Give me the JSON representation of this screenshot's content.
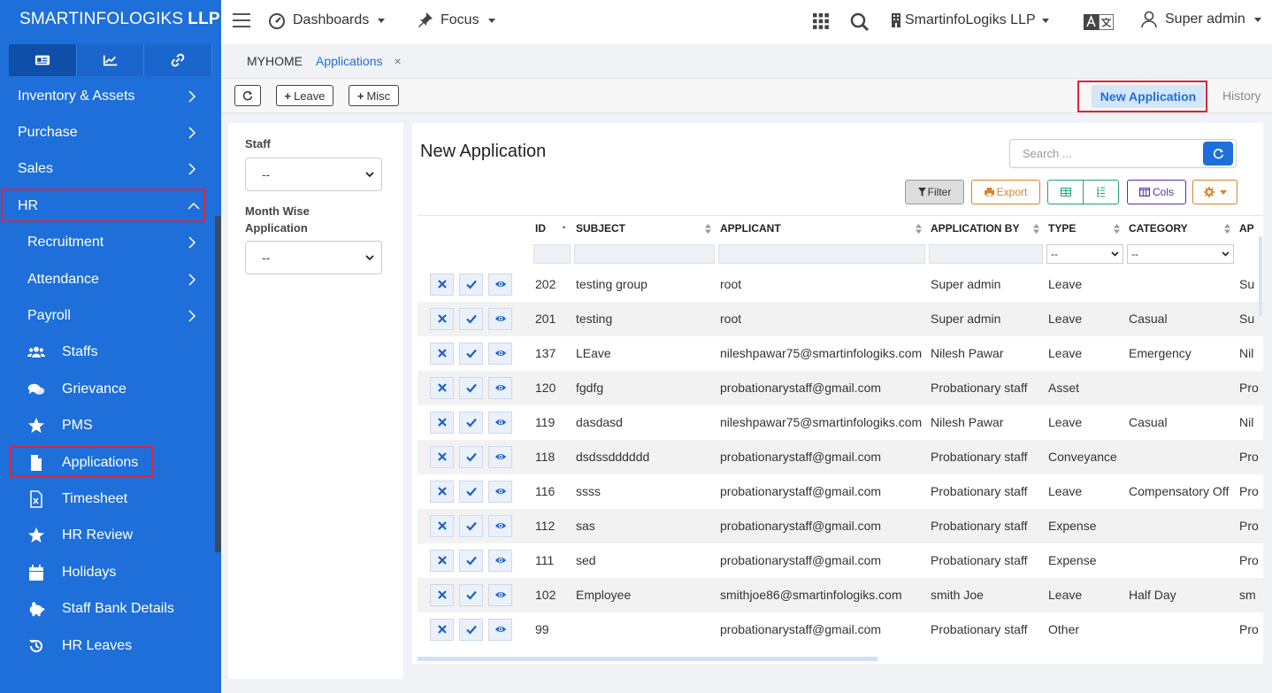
{
  "brand": {
    "name": "SMARTINFOLOGIKS",
    "suffix": "LLP"
  },
  "sidebar": {
    "tabs": [
      {
        "icon": "id-card-icon"
      },
      {
        "icon": "chart-line-icon"
      },
      {
        "icon": "link-icon"
      }
    ],
    "items": [
      {
        "label": "Inventory & Assets",
        "level": "top",
        "chevron": "right"
      },
      {
        "label": "Purchase",
        "level": "top",
        "chevron": "right"
      },
      {
        "label": "Sales",
        "level": "top",
        "chevron": "right"
      },
      {
        "label": "HR",
        "level": "top",
        "chevron": "up"
      },
      {
        "label": "Recruitment",
        "level": "sub",
        "chevron": "right"
      },
      {
        "label": "Attendance",
        "level": "sub",
        "chevron": "right"
      },
      {
        "label": "Payroll",
        "level": "sub",
        "chevron": "right"
      },
      {
        "label": "Staffs",
        "level": "leaf",
        "icon": "users-icon"
      },
      {
        "label": "Grievance",
        "level": "leaf",
        "icon": "comments-icon"
      },
      {
        "label": "PMS",
        "level": "leaf",
        "icon": "star-icon"
      },
      {
        "label": "Applications",
        "level": "leaf",
        "icon": "file-icon"
      },
      {
        "label": "Timesheet",
        "level": "leaf",
        "icon": "excel-file-icon"
      },
      {
        "label": "HR Review",
        "level": "leaf",
        "icon": "star-icon"
      },
      {
        "label": "Holidays",
        "level": "leaf",
        "icon": "calendar-icon"
      },
      {
        "label": "Staff Bank Details",
        "level": "leaf",
        "icon": "piggy-bank-icon"
      },
      {
        "label": "HR Leaves",
        "level": "leaf",
        "icon": "history-icon"
      }
    ]
  },
  "topbar": {
    "dashboards": "Dashboards",
    "focus": "Focus",
    "company": "SmartinfoLogiks LLP",
    "user": "Super admin"
  },
  "tabstrip": {
    "home": "MYHOME",
    "current": "Applications",
    "close": "×"
  },
  "actions": {
    "leave": "Leave",
    "misc": "Misc",
    "new_application": "New Application",
    "history": "History"
  },
  "filters": {
    "staff_label": "Staff",
    "staff_value": "--",
    "month_label_1": "Month Wise",
    "month_label_2": "Application",
    "month_value": "--"
  },
  "main": {
    "title": "New Application",
    "search_placeholder": "Search ...",
    "toolbar": {
      "filter": "Filter",
      "export": "Export",
      "cols": "Cols"
    },
    "columns": [
      "",
      "ID",
      "SUBJECT",
      "APPLICANT",
      "APPLICATION BY",
      "TYPE",
      "CATEGORY",
      "AP"
    ],
    "filter_select": "--",
    "rows": [
      {
        "id": "202",
        "subject": "testing group",
        "applicant": "root",
        "by": "Super admin",
        "type": "Leave",
        "category": "",
        "ap": "Su"
      },
      {
        "id": "201",
        "subject": "testing",
        "applicant": "root",
        "by": "Super admin",
        "type": "Leave",
        "category": "Casual",
        "ap": "Su"
      },
      {
        "id": "137",
        "subject": "LEave",
        "applicant": "nileshpawar75@smartinfologiks.com",
        "by": "Nilesh Pawar",
        "type": "Leave",
        "category": "Emergency",
        "ap": "Nil"
      },
      {
        "id": "120",
        "subject": "fgdfg",
        "applicant": "probationarystaff@gmail.com",
        "by": "Probationary staff",
        "type": "Asset",
        "category": "",
        "ap": "Pro"
      },
      {
        "id": "119",
        "subject": "dasdasd",
        "applicant": "nileshpawar75@smartinfologiks.com",
        "by": "Nilesh Pawar",
        "type": "Leave",
        "category": "Casual",
        "ap": "Nil"
      },
      {
        "id": "118",
        "subject": "dsdssdddddd",
        "applicant": "probationarystaff@gmail.com",
        "by": "Probationary staff",
        "type": "Conveyance",
        "category": "",
        "ap": "Pro"
      },
      {
        "id": "116",
        "subject": "ssss",
        "applicant": "probationarystaff@gmail.com",
        "by": "Probationary staff",
        "type": "Leave",
        "category": "Compensatory Off",
        "ap": "Pro"
      },
      {
        "id": "112",
        "subject": "sas",
        "applicant": "probationarystaff@gmail.com",
        "by": "Probationary staff",
        "type": "Expense",
        "category": "",
        "ap": "Pro"
      },
      {
        "id": "111",
        "subject": "sed",
        "applicant": "probationarystaff@gmail.com",
        "by": "Probationary staff",
        "type": "Expense",
        "category": "",
        "ap": "Pro"
      },
      {
        "id": "102",
        "subject": "Employee",
        "applicant": "smithjoe86@smartinfologiks.com",
        "by": "smith Joe",
        "type": "Leave",
        "category": "Half Day",
        "ap": "sm"
      },
      {
        "id": "99",
        "subject": "",
        "applicant": "probationarystaff@gmail.com",
        "by": "Probationary staff",
        "type": "Other",
        "category": "",
        "ap": "Pro"
      }
    ]
  },
  "colors": {
    "sidebar": "#1e6fd9",
    "accent": "#1e6fd9",
    "highlight": "#d9263a",
    "export": "#d9822b",
    "table_btn": "#1fa17a",
    "cols": "#5a2bb5"
  }
}
